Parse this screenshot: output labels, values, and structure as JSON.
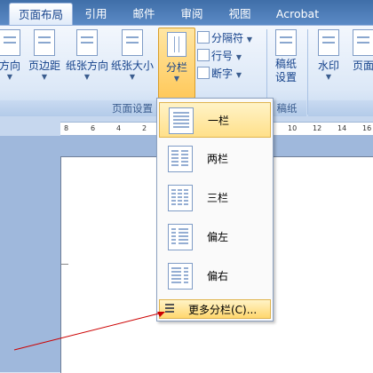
{
  "tabs": [
    "页面布局",
    "引用",
    "邮件",
    "审阅",
    "视图",
    "Acrobat"
  ],
  "ribbon": {
    "buttons": [
      "方向",
      "页边距",
      "纸张方向",
      "纸张大小",
      "分栏"
    ],
    "small_buttons": [
      "分隔符",
      "行号",
      "断字"
    ],
    "gaozhi": "稿纸\n设置",
    "watermark": "水印",
    "page_cut": "页面",
    "group_page_setup": "页面设置",
    "group_gaozhi": "稿纸"
  },
  "ruler": [
    "8",
    "6",
    "4",
    "2",
    "10",
    "12",
    "14",
    "16"
  ],
  "menu": {
    "items": [
      "一栏",
      "两栏",
      "三栏",
      "偏左",
      "偏右"
    ],
    "more": "更多分栏(C)..."
  },
  "colors": {
    "accent": "#ffc95b",
    "tab_bar": "#3f6ea8",
    "annotation": "#cc0000"
  }
}
